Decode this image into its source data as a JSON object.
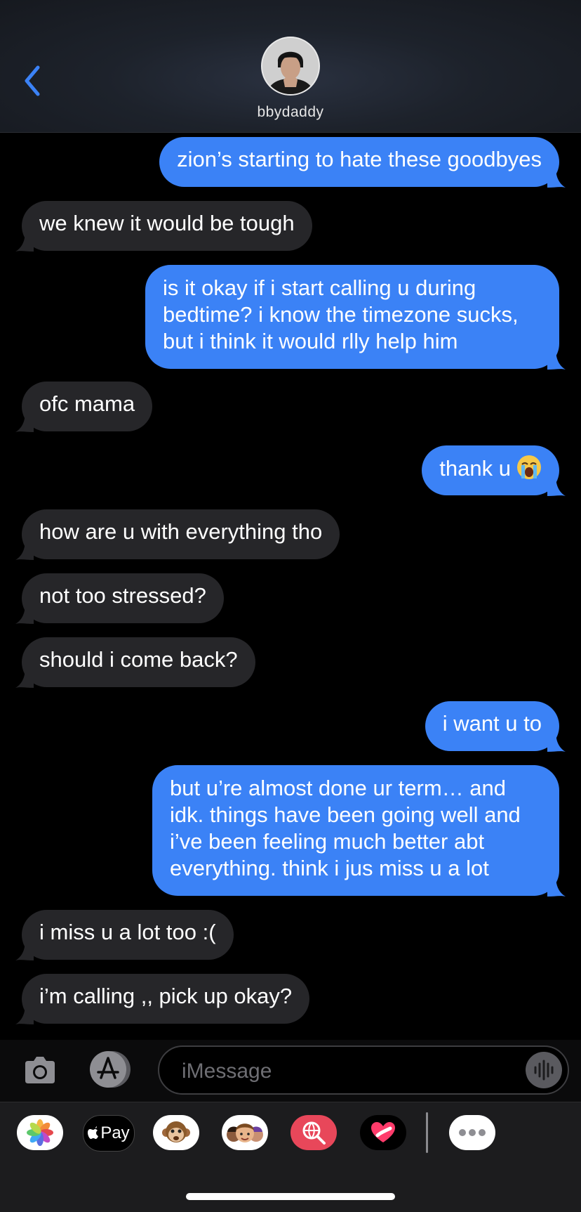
{
  "header": {
    "contact_name": "bbydaddy",
    "back_icon": "chevron-left-icon"
  },
  "messages": [
    {
      "side": "sent",
      "text": "zion’s starting to hate these goodbyes"
    },
    {
      "side": "recv",
      "text": "we knew it would be tough"
    },
    {
      "side": "sent",
      "text": "is it okay if i start calling u during bedtime? i know the timezone sucks, but i think it would rlly help him"
    },
    {
      "side": "recv",
      "text": "ofc mama"
    },
    {
      "side": "sent",
      "text": "thank u",
      "emoji": "loudly-crying-face"
    },
    {
      "side": "recv",
      "text": "how are u with everything tho"
    },
    {
      "side": "recv",
      "text": "not too stressed?"
    },
    {
      "side": "recv",
      "text": "should i come back?"
    },
    {
      "side": "sent",
      "text": "i want u to"
    },
    {
      "side": "sent",
      "text": "but u’re almost done ur term… and idk. things have been going well and i’ve been feeling much better abt everything. think i jus miss u a lot"
    },
    {
      "side": "recv",
      "text": "i miss u a lot too :("
    },
    {
      "side": "recv",
      "text": "i’m calling ,, pick up okay?"
    }
  ],
  "input": {
    "placeholder": "iMessage"
  },
  "apps": [
    {
      "name": "photos",
      "icon": "photos-icon"
    },
    {
      "name": "apple-pay",
      "icon": "apple-pay-icon",
      "label": "Pay"
    },
    {
      "name": "animoji",
      "icon": "monkey-icon"
    },
    {
      "name": "memoji",
      "icon": "memoji-icon"
    },
    {
      "name": "images-search",
      "icon": "globe-search-icon"
    },
    {
      "name": "digital-touch",
      "icon": "heart-touch-icon"
    },
    {
      "name": "more",
      "icon": "more-icon"
    }
  ],
  "colors": {
    "sent_bubble": "#3b82f6",
    "recv_bubble": "#262629",
    "accent": "#3b82f6"
  }
}
